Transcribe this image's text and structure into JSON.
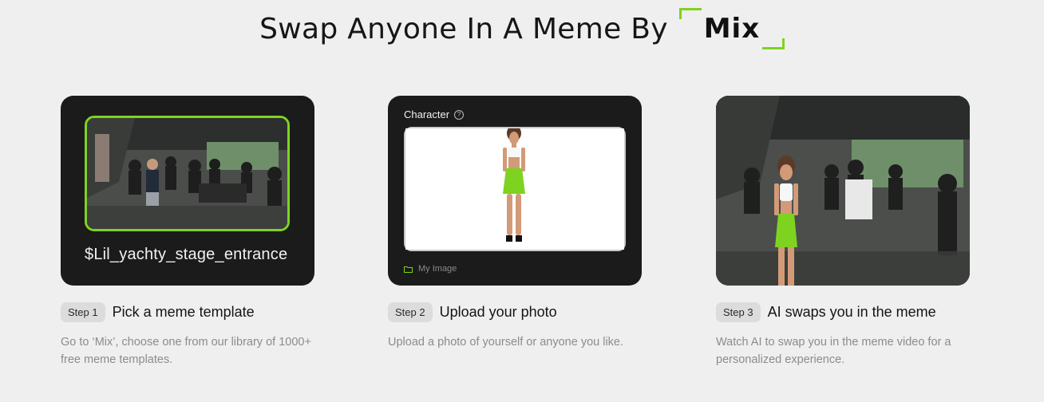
{
  "header": {
    "title": "Swap Anyone In A Meme By",
    "logo_text": "Mix",
    "accent_color": "#7ed321"
  },
  "cards": {
    "template": {
      "name": "$Lil_yachty_stage_entrance",
      "image": "meme-template-thumbnail"
    },
    "upload": {
      "label": "Character",
      "help_icon": "?",
      "image_label": "My Image",
      "image": "uploaded-person-photo"
    },
    "result": {
      "image": "swapped-meme-result"
    }
  },
  "steps": [
    {
      "badge": "Step 1",
      "title": "Pick a meme template",
      "description": "Go to ‘Mix’, choose one from our library of 1000+ free meme templates."
    },
    {
      "badge": "Step 2",
      "title": "Upload your photo",
      "description": "Upload a photo of yourself or anyone you like."
    },
    {
      "badge": "Step 3",
      "title": "AI swaps you in the meme",
      "description": "Watch AI to swap you in the meme video for a personalized experience."
    }
  ]
}
